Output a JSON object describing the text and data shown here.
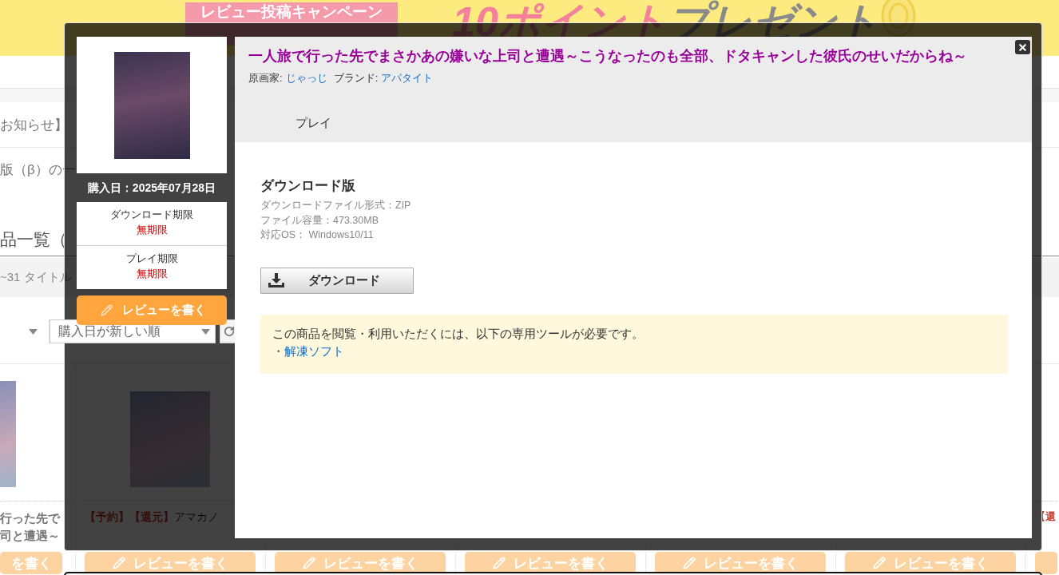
{
  "banner": {
    "ribbon": "レビュー投稿キャンペーン",
    "headline_accent": "10ポイント",
    "headline_rest": "プレゼント"
  },
  "notices": [
    "お知らせ】",
    "版（β）の一"
  ],
  "list": {
    "heading": "品一覧（",
    "count": "~31 タイトル",
    "sort": "購入日が新しい順"
  },
  "products": [
    {
      "kind": "edge",
      "title_lines": [
        "行った先で",
        "司と遭遇～"
      ],
      "button": "を書く"
    },
    {
      "kind": "listing",
      "tags": [
        "【予約】",
        "【還元】"
      ],
      "title": "アマカノ",
      "button": "レビューを書く"
    },
    {
      "kind": "covered",
      "button": "レビューを書く"
    },
    {
      "kind": "covered",
      "button": "レビューを書く"
    },
    {
      "kind": "covered",
      "button": "レビューを書く"
    },
    {
      "kind": "covered",
      "button": "レビューを書く"
    },
    {
      "kind": "clipped",
      "tags": [
        "【還"
      ]
    }
  ],
  "modal": {
    "purchase_date": "購入日：2025年07月28日",
    "deadlines": [
      {
        "label": "ダウンロード期限",
        "value": "無期限"
      },
      {
        "label": "プレイ期限",
        "value": "無期限"
      }
    ],
    "review_button": "レビューを書く",
    "title": "一人旅で行った先でまさかあの嫌いな上司と遭遇～こうなったのも全部、ドタキャンした彼氏のせいだからね～",
    "credits": [
      {
        "label": "原画家:",
        "value": "じゃっじ"
      },
      {
        "label": "ブランド:",
        "value": "アパタイト"
      }
    ],
    "tab": "プレイ",
    "section": {
      "heading": "ダウンロード版",
      "details": [
        "ダウンロードファイル形式：ZIP",
        "ファイル容量：473.30MB",
        "対応OS： Windows10/11"
      ],
      "download_button": "ダウンロード"
    },
    "notice": {
      "text": "この商品を閲覧・利用いただくには、以下の専用ツールが必要です。",
      "bullet": "・",
      "link": "解凍ソフト"
    }
  }
}
